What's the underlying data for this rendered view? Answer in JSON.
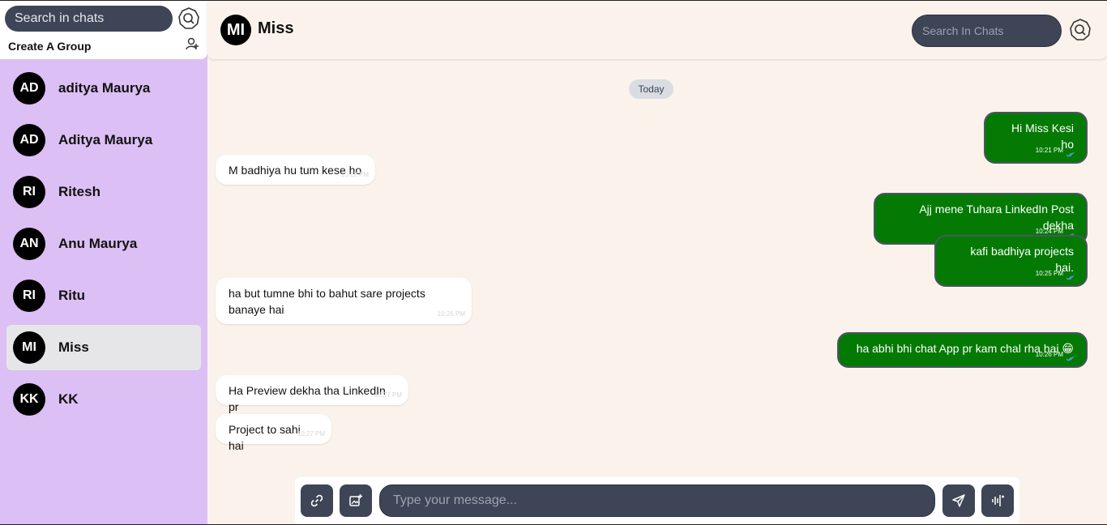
{
  "sidebar": {
    "search_placeholder": "Search in chats",
    "create_group_label": "Create A Group",
    "contacts": [
      {
        "initials": "AD",
        "name": "aditya Maurya"
      },
      {
        "initials": "AD",
        "name": "Aditya Maurya"
      },
      {
        "initials": "RI",
        "name": "Ritesh"
      },
      {
        "initials": "AN",
        "name": "Anu Maurya"
      },
      {
        "initials": "RI",
        "name": "Ritu"
      },
      {
        "initials": "MI",
        "name": "Miss"
      },
      {
        "initials": "KK",
        "name": "KK"
      }
    ],
    "active_contact": "Miss"
  },
  "header": {
    "initials": "MI",
    "name": "Miss",
    "search_placeholder": "Search In Chats"
  },
  "chat": {
    "date_label": "Today",
    "messages": [
      {
        "dir": "out",
        "text": "Hi Miss Kesi ho",
        "time": "10:21 PM"
      },
      {
        "dir": "in",
        "text": "M badhiya hu tum kese ho",
        "time": "10:22 PM"
      },
      {
        "dir": "out",
        "text": "Ajj mene Tuhara LinkedIn Post dekha",
        "time": "10:24 PM"
      },
      {
        "dir": "out",
        "text": "kafi badhiya projects hai.",
        "time": "10:25 PM"
      },
      {
        "dir": "in",
        "text": "ha but tumne bhi to bahut sare projects banaye hai",
        "time": "10:26 PM"
      },
      {
        "dir": "out",
        "text": "ha abhi bhi chat App pr kam chal rha hai 😁",
        "time": "10:26 PM"
      },
      {
        "dir": "in",
        "text": "Ha Preview dekha tha LinkedIn pr",
        "time": "10:27 PM"
      },
      {
        "dir": "in",
        "text": "Project to sahi hai",
        "time": "10:27 PM"
      }
    ]
  },
  "composer": {
    "placeholder": "Type your message..."
  },
  "colors": {
    "sidebar_bg": "#dcbff5",
    "chat_bg": "#fbf3eb",
    "outgoing_bubble": "#047a04",
    "input_bg": "#3d4556"
  }
}
